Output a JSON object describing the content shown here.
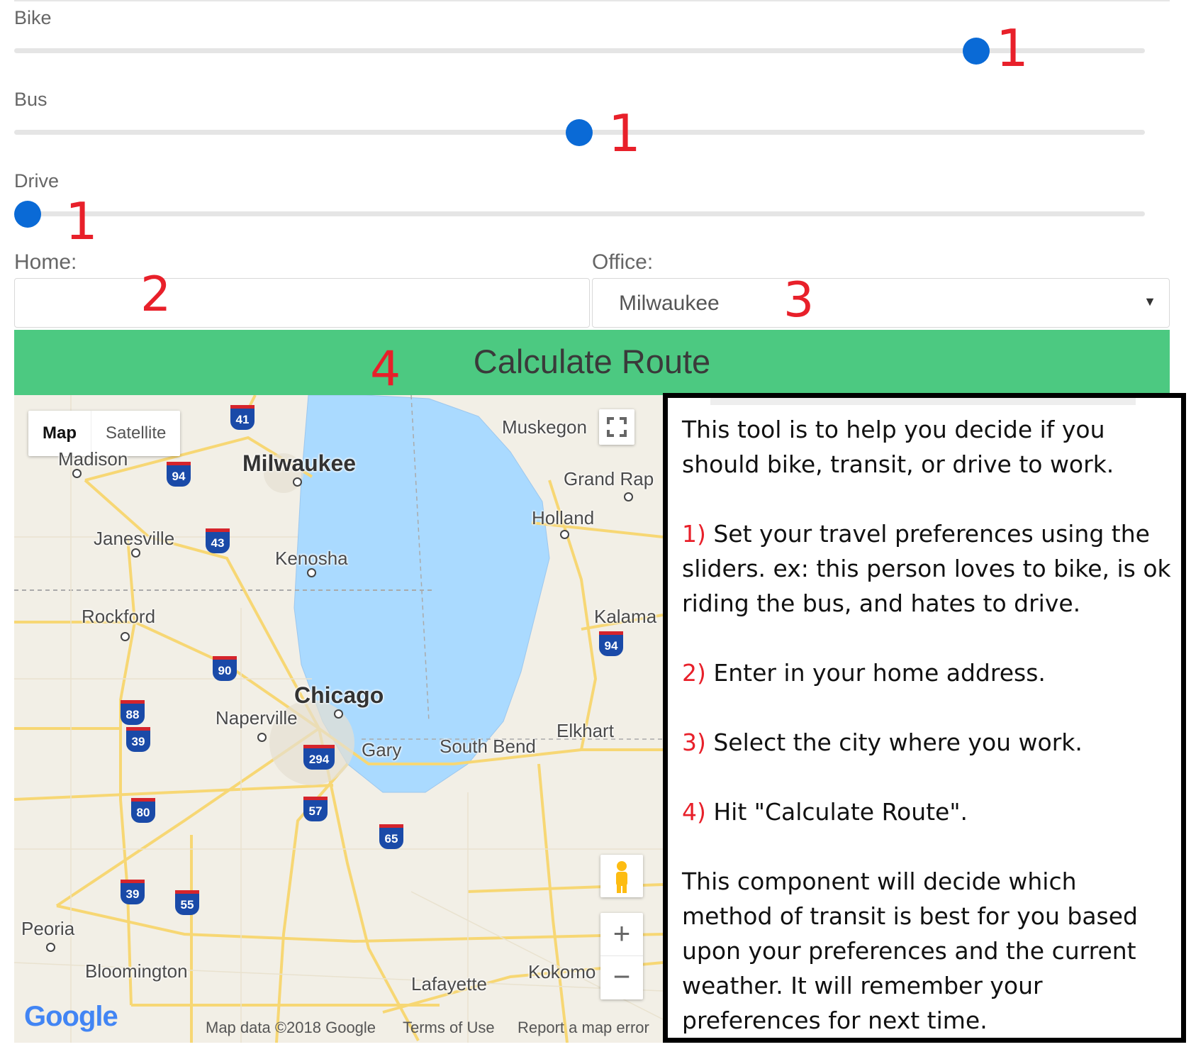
{
  "sliders": [
    {
      "label": "Bike",
      "value": 0.85,
      "annotation": "1"
    },
    {
      "label": "Bus",
      "value": 0.5,
      "annotation": "1"
    },
    {
      "label": "Drive",
      "value": 0.0,
      "annotation": "1"
    }
  ],
  "form": {
    "home_label": "Home:",
    "home_value": "",
    "home_annotation": "2",
    "office_label": "Office:",
    "office_value": "Milwaukee",
    "office_annotation": "3"
  },
  "calculate_button": {
    "label": "Calculate Route",
    "annotation": "4",
    "color": "#4cc981"
  },
  "map": {
    "type_controls": [
      "Map",
      "Satellite"
    ],
    "cities": {
      "milwaukee": "Milwaukee",
      "madison": "Madison",
      "muskegon": "Muskegon",
      "grand_rapids": "Grand Rap",
      "holland": "Holland",
      "janesville": "Janesville",
      "kenosha": "Kenosha",
      "rockford": "Rockford",
      "kalamazoo": "Kalama",
      "chicago": "Chicago",
      "naperville": "Naperville",
      "gary": "Gary",
      "south_bend": "South Bend",
      "elkhart": "Elkhart",
      "peoria": "Peoria",
      "bloomington": "Bloomington",
      "lafayette": "Lafayette",
      "kokomo": "Kokomo"
    },
    "shields": {
      "i41": "41",
      "i94a": "94",
      "i43": "43",
      "i94b": "94",
      "i90": "90",
      "i88": "88",
      "i39a": "39",
      "i294": "294",
      "i80": "80",
      "i57": "57",
      "i65": "65",
      "i39b": "39",
      "i55": "55"
    },
    "footer": {
      "data": "Map data ©2018 Google",
      "terms": "Terms of Use",
      "report": "Report a map error"
    },
    "logo": "Google",
    "zoom_in": "+",
    "zoom_out": "−"
  },
  "instructions": {
    "intro": "This tool is to help you decide if you should bike, transit, or drive to work.",
    "step1_num": "1)",
    "step1": " Set your travel preferences using the sliders. ex: this person loves to bike, is ok riding the bus, and hates to drive.",
    "step2_num": "2)",
    "step2": " Enter in your home address.",
    "step3_num": "3)",
    "step3": " Select the city where you work.",
    "step4_num": "4)",
    "step4": " Hit \"Calculate Route\".",
    "outro": "This component will decide which method of transit is best for you based upon your preferences and the current weather. It will remember your preferences for next time."
  }
}
